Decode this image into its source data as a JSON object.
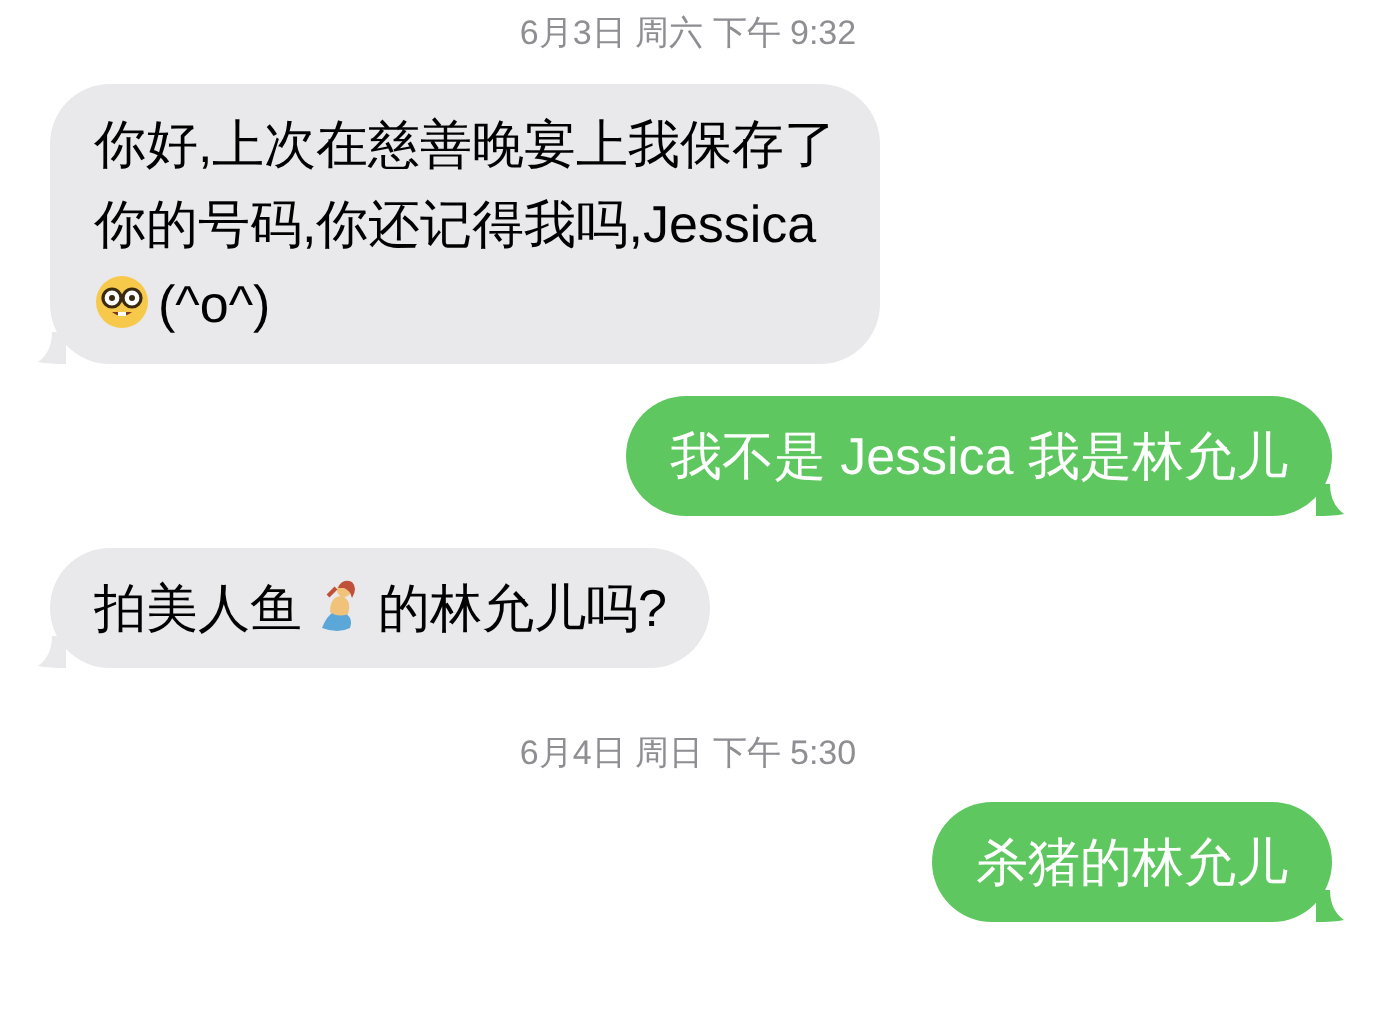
{
  "conversation": [
    {
      "kind": "time",
      "text": "6月3日 周六 下午 9:32"
    },
    {
      "kind": "message",
      "outgoing": false,
      "segments": [
        {
          "kind": "line",
          "text": "你好,上次在慈善晚宴上我保存了"
        },
        {
          "kind": "line",
          "text": "你的号码,你还记得我吗,Jessica"
        },
        {
          "kind": "face"
        },
        {
          "kind": "text",
          "text": "(^o^)"
        }
      ]
    },
    {
      "kind": "message",
      "outgoing": true,
      "segments": [
        {
          "kind": "text",
          "text": "我不是 Jessica 我是林允儿"
        }
      ]
    },
    {
      "kind": "message",
      "outgoing": false,
      "segments": [
        {
          "kind": "text",
          "text": "拍美人鱼"
        },
        {
          "kind": "mermaid"
        },
        {
          "kind": "text",
          "text": "的林允儿吗?"
        }
      ]
    },
    {
      "kind": "time",
      "text": "6月4日 周日 下午 5:30"
    },
    {
      "kind": "message",
      "outgoing": true,
      "segments": [
        {
          "kind": "text",
          "text": "杀猪的林允儿"
        }
      ]
    }
  ]
}
